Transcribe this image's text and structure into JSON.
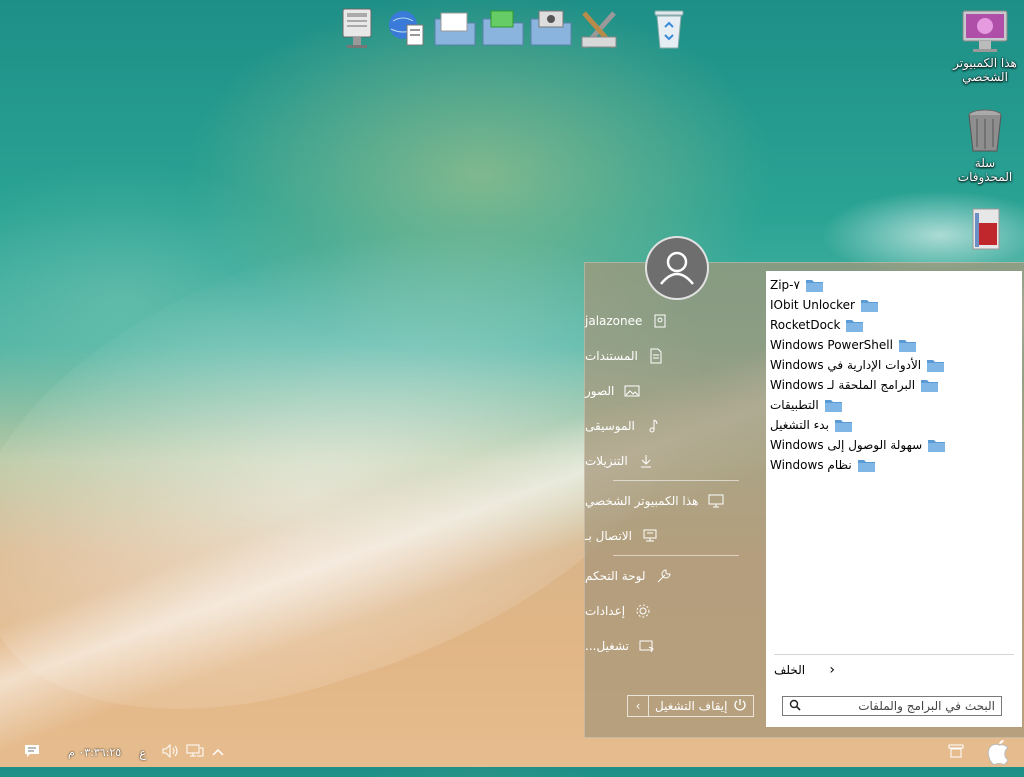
{
  "desktop": {
    "icons": [
      {
        "label": "هذا الكمبيوتر الشخصي",
        "icon": "imac-icon"
      },
      {
        "label": "سلة المحذوفات",
        "icon": "trash-icon"
      },
      {
        "label": "",
        "icon": "archive-icon"
      }
    ]
  },
  "dock": {
    "items": [
      "display-settings-icon",
      "network-globe-icon",
      "documents-folder-icon",
      "pictures-folder-icon",
      "media-folder-icon",
      "tools-icon",
      "recycle-bin-icon"
    ]
  },
  "start_menu": {
    "user": {
      "name": "jalazonee",
      "avatar": "user-avatar-icon"
    },
    "left_items": [
      {
        "label": "jalazonee",
        "icon": "user-folder-icon"
      },
      {
        "label": "المستندات",
        "icon": "document-icon"
      },
      {
        "label": "الصور",
        "icon": "image-icon"
      },
      {
        "label": "الموسيقى",
        "icon": "music-note-icon"
      },
      {
        "label": "التنزيلات",
        "icon": "download-icon"
      },
      {
        "label": "هذا الكمبيوتر الشخصي",
        "icon": "computer-icon"
      },
      {
        "label": "الاتصال بـ",
        "icon": "connect-icon"
      },
      {
        "label": "لوحة التحكم",
        "icon": "wrench-icon"
      },
      {
        "label": "إعدادات",
        "icon": "gear-icon"
      },
      {
        "label": "تشغيل...",
        "icon": "run-icon"
      }
    ],
    "power": {
      "label": "إيقاف التشغيل",
      "arrow": "‹"
    },
    "programs": [
      "Zip-۷",
      "IObit Unlocker",
      "RocketDock",
      "Windows PowerShell",
      "الأدوات الإدارية في Windows",
      "البرامج الملحقة لـ Windows",
      "التطبيقات",
      "بدء التشغيل",
      "سهولة الوصول إلى Windows",
      "نظام Windows"
    ],
    "back_label": "الخلف",
    "search_placeholder": "البحث في البرامج والملفات"
  },
  "taskbar": {
    "clock": "٠٣:٣٦:٢٥ م",
    "language": "ع",
    "tray_icons": [
      "notification-icon",
      "volume-icon",
      "network-icon",
      "chevron-up-icon"
    ]
  },
  "colors": {
    "menu_bg": "#a5967899",
    "folder": "#5b9bd5"
  }
}
